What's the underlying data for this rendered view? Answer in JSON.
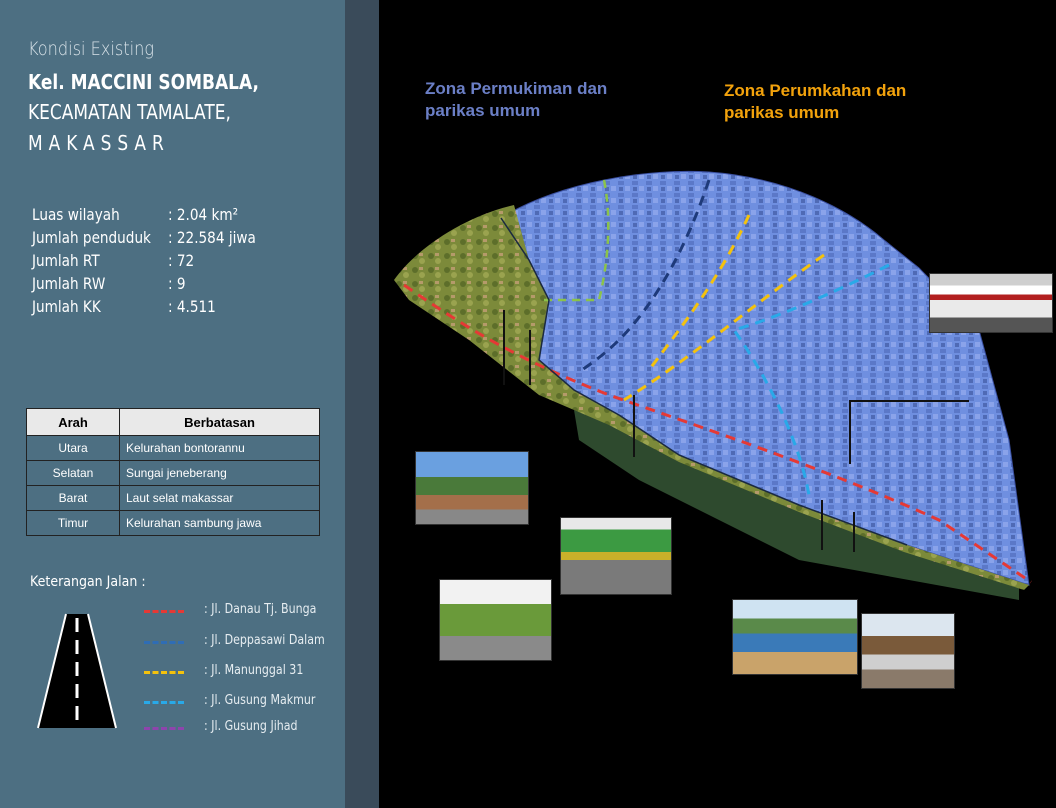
{
  "header": {
    "condition": "Kondisi Existing",
    "kelurahan": "Kel. MACCINI SOMBALA,",
    "kecamatan": "KECAMATAN TAMALATE,",
    "kota": "MAKASSAR"
  },
  "stats": [
    {
      "label": "Luas wilayah",
      "value": ": 2.04 km²"
    },
    {
      "label": "Jumlah penduduk",
      "value": ": 22.584 jiwa"
    },
    {
      "label": "Jumlah RT",
      "value": ": 72"
    },
    {
      "label": "Jumlah RW",
      "value": ": 9"
    },
    {
      "label": "Jumlah KK",
      "value": ": 4.511"
    }
  ],
  "boundary_table": {
    "headers": [
      "Arah",
      "Berbatasan"
    ],
    "rows": [
      [
        "Utara",
        "Kelurahan bontorannu"
      ],
      [
        "Selatan",
        "Sungai jeneberang"
      ],
      [
        "Barat",
        "Laut selat makassar"
      ],
      [
        "Timur",
        "Kelurahan sambung jawa"
      ]
    ]
  },
  "legend": {
    "title": "Keterangan Jalan :",
    "items": [
      {
        "name": ":  Jl. Danau Tj. Bunga",
        "color": "#e53935"
      },
      {
        "name": ":  Jl. Deppasawi Dalam",
        "color": "#2f6db5"
      },
      {
        "name": ":  Jl. Manunggal 31",
        "color": "#f4c20d"
      },
      {
        "name": ":  Jl. Gusung Makmur",
        "color": "#29a9e8"
      },
      {
        "name": ":  Jl. Gusung Jihad",
        "color": "#8e44ad"
      }
    ]
  },
  "zones": {
    "permukiman": "Zona Permukiman dan parikas umum",
    "perdagangan": "Zona Perumkahan dan parikas umum"
  },
  "colors": {
    "sidebar": "#4d6f82",
    "divider": "#3a4b5a",
    "zone_blue": "#6f8fe0",
    "zone_green": "#7c8a3a",
    "zone_label_blue": "#6b7fc6",
    "zone_label_orange": "#f2a20c"
  }
}
